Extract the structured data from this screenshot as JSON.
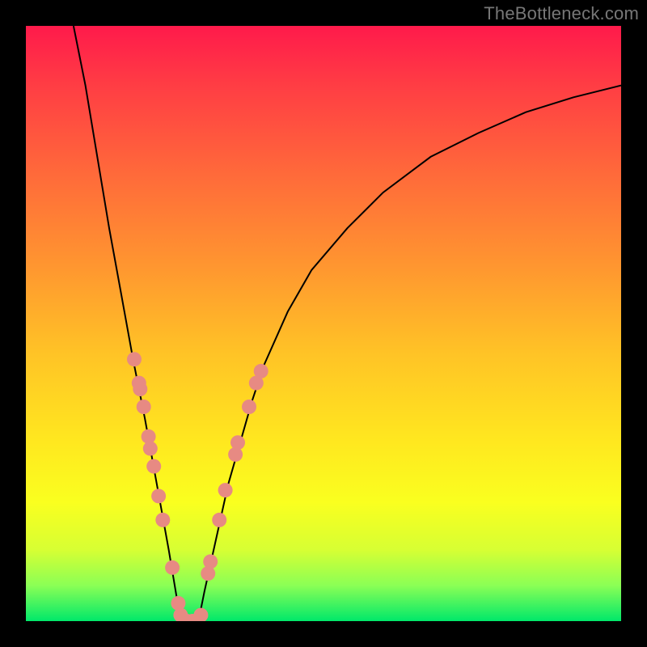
{
  "watermark": {
    "text": "TheBottleneck.com"
  },
  "colors": {
    "bg": "#000000",
    "curve": "#000000",
    "marker_fill": "#e78a83",
    "marker_stroke": "#c46e66"
  },
  "chart_data": {
    "type": "line",
    "title": "",
    "xlabel": "",
    "ylabel": "",
    "xlim": [
      0,
      100
    ],
    "ylim": [
      0,
      100
    ],
    "grid": false,
    "legend": false,
    "min_x": 26,
    "curve_left": {
      "x": [
        8,
        10,
        12,
        14,
        16,
        18,
        20,
        22,
        24,
        25,
        26
      ],
      "y": [
        100,
        90,
        78,
        66,
        55,
        44,
        34,
        23,
        12,
        6,
        0
      ]
    },
    "curve_right": {
      "x": [
        29,
        30,
        32,
        34,
        36,
        38,
        40,
        44,
        48,
        54,
        60,
        68,
        76,
        84,
        92,
        100
      ],
      "y": [
        0,
        5,
        14,
        23,
        30,
        37,
        43,
        52,
        59,
        66,
        72,
        78,
        82,
        85.5,
        88,
        90
      ]
    },
    "flat_bottom": {
      "x": [
        26,
        29
      ],
      "y": [
        0,
        0
      ]
    },
    "markers": [
      {
        "x": 18.2,
        "y": 44
      },
      {
        "x": 19.0,
        "y": 40
      },
      {
        "x": 19.2,
        "y": 39
      },
      {
        "x": 19.8,
        "y": 36
      },
      {
        "x": 20.6,
        "y": 31
      },
      {
        "x": 20.9,
        "y": 29
      },
      {
        "x": 21.5,
        "y": 26
      },
      {
        "x": 22.3,
        "y": 21
      },
      {
        "x": 23.0,
        "y": 17
      },
      {
        "x": 24.6,
        "y": 9
      },
      {
        "x": 25.6,
        "y": 3
      },
      {
        "x": 26.0,
        "y": 1
      },
      {
        "x": 27.0,
        "y": 0
      },
      {
        "x": 28.0,
        "y": 0
      },
      {
        "x": 28.8,
        "y": 0
      },
      {
        "x": 29.4,
        "y": 1
      },
      {
        "x": 30.6,
        "y": 8
      },
      {
        "x": 31.0,
        "y": 10
      },
      {
        "x": 32.5,
        "y": 17
      },
      {
        "x": 33.5,
        "y": 22
      },
      {
        "x": 35.2,
        "y": 28
      },
      {
        "x": 35.6,
        "y": 30
      },
      {
        "x": 37.5,
        "y": 36
      },
      {
        "x": 38.7,
        "y": 40
      },
      {
        "x": 39.5,
        "y": 42
      }
    ]
  }
}
